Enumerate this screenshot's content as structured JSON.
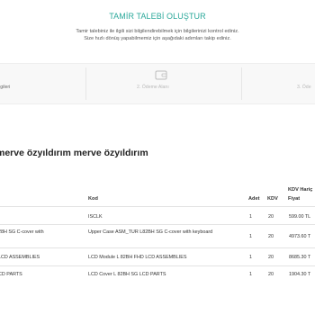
{
  "header": {
    "title": "TAMİR TALEBİ OLUŞTUR",
    "subtitle_line1": "Tamir talebiniz ile ilgili sizi bilgilendirebilmek için bilgilerinizi kontrol ediniz.",
    "subtitle_line2": "Size hızlı dönüş yapabilmemiz için aşağıdaki adımları takip ediniz."
  },
  "steps": [
    {
      "label": "ilgileri",
      "state": "done"
    },
    {
      "label": "2. Ödeme Alanı",
      "state": "current",
      "icon": "wallet-icon"
    },
    {
      "label": "3. Öde",
      "state": "pending"
    }
  ],
  "section": {
    "heading": "merve özyıldırım merve özyıldırım"
  },
  "table": {
    "columns": {
      "kod": "Kod",
      "adet": "Adet",
      "kdv": "KDV",
      "kdv_haric_fiyat_line1": "KDV Hariç",
      "kdv_haric_fiyat_line2": "Fiyat"
    },
    "rows": [
      {
        "description": "",
        "kod": "ISCLK",
        "adet": "1",
        "kdv": "20",
        "price": "599.00 TL"
      },
      {
        "description": "28H SG C-cover with",
        "kod": "Upper Case ASM_TUR L82BH SG C-cover with keyboard",
        "adet": "1",
        "kdv": "20",
        "price": "4973.60 T"
      },
      {
        "description": "LCD ASSEMBLIES",
        "kod": "LCD Module L 82BH FHD LCD ASSEMBLIES",
        "adet": "1",
        "kdv": "20",
        "price": "8685.30 T"
      },
      {
        "description": "CD PARTS",
        "kod": "LCD Cover L 82BH SG LCD PARTS",
        "adet": "1",
        "kdv": "20",
        "price": "1904.30 T"
      }
    ]
  }
}
